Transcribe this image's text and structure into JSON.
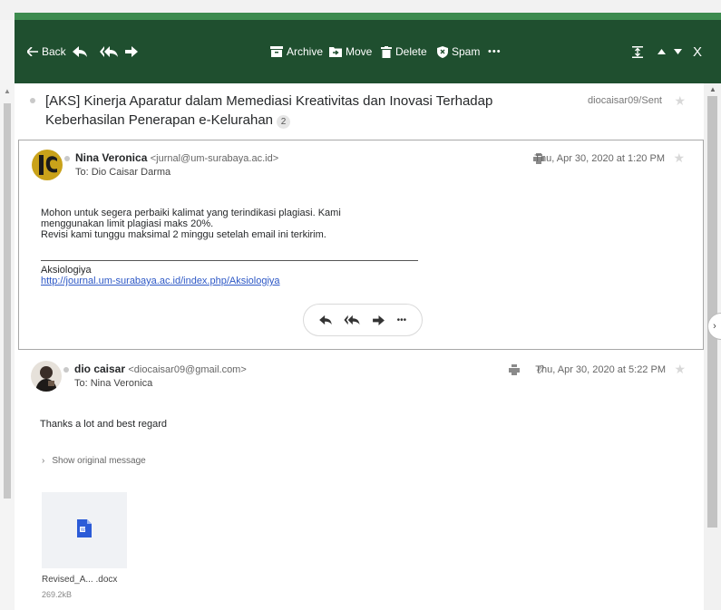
{
  "toolbar": {
    "back_label": "Back",
    "archive_label": "Archive",
    "move_label": "Move",
    "delete_label": "Delete",
    "spam_label": "Spam",
    "more_label": "•••",
    "close_label": "X"
  },
  "thread": {
    "subject": "[AKS] Kinerja Aparatur dalam Memediasi Kreativitas dan Inovasi Terhadap Keberhasilan Penerapan e-Kelurahan",
    "count": "2",
    "folder": "diocaisar09/Sent"
  },
  "messages": [
    {
      "sender_name": "Nina Veronica",
      "sender_email": "<jurnal@um-surabaya.ac.id>",
      "to": "To: Dio Caisar Darma",
      "date": "Thu, Apr 30, 2020 at 1:20 PM",
      "body_lines": [
        "Mohon untuk segera perbaiki kalimat yang terindikasi plagiasi. Kami",
        "menggunakan limit plagiasi maks 20%.",
        "Revisi kami tunggu maksimal 2 minggu setelah email ini terkirim."
      ],
      "signature_name": "Aksiologiya",
      "signature_link": "http://journal.um-surabaya.ac.id/index.php/Aksiologiya",
      "reply_more": "•••"
    },
    {
      "sender_name": "dio caisar",
      "sender_email": "<diocaisar09@gmail.com>",
      "to": "To: Nina Veronica",
      "date": "Thu, Apr 30, 2020 at 5:22 PM",
      "body": "Thanks a lot and best regard",
      "show_original": "Show original message",
      "attachment_name": "Revised_A...  .docx",
      "attachment_size": "269.2kB"
    }
  ],
  "colors": {
    "toolbar_bg": "#1f4f2f",
    "accent_green": "#3d8b4f",
    "link": "#2d58c6",
    "word_icon": "#2b5bd7"
  }
}
